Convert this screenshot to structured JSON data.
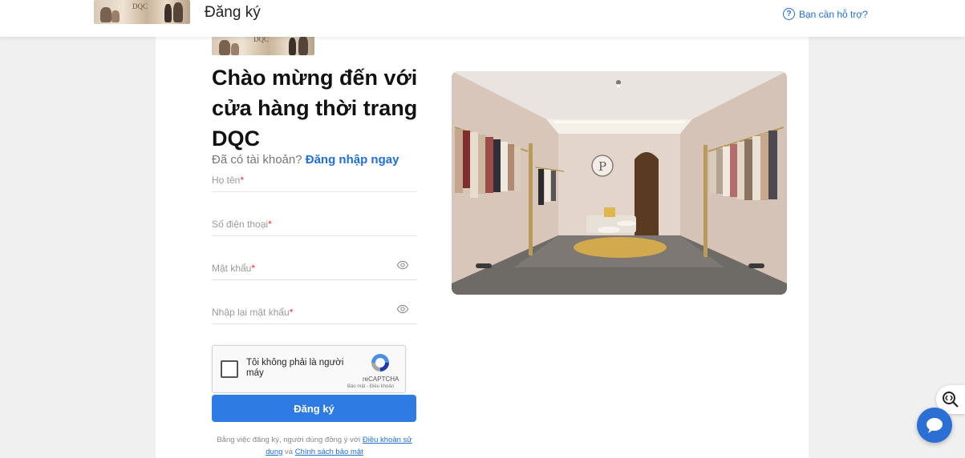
{
  "header": {
    "logo_text": "DQC",
    "title": "Đăng ký",
    "help_label": "Bạn cần hỗ trợ?",
    "help_icon": "question-circle-icon"
  },
  "form": {
    "logo_text": "DQC",
    "heading": "Chào mừng đến với cửa hàng thời trang DQC",
    "have_account": "Đã có tài khoản?",
    "login_link": "Đăng nhập ngay",
    "fields": [
      {
        "label": "Họ tên",
        "required": "*"
      },
      {
        "label": "Số điện thoại",
        "required": "*"
      },
      {
        "label": "Mật khẩu",
        "required": "*",
        "icon": "eye-icon"
      },
      {
        "label": "Nhập lại mật khẩu",
        "required": "*",
        "icon": "eye-icon"
      }
    ],
    "recaptcha": {
      "text": "Tôi không phải là người máy",
      "brand": "reCAPTCHA",
      "links": "Bảo mật - Điều khoản"
    },
    "submit_label": "Đăng ký",
    "terms": {
      "prefix": "Bằng việc đăng ký, người dùng đồng ý với",
      "link1": "Điều khoản sử dụng",
      "middle": "và",
      "link2": "Chính sách bảo mật"
    }
  },
  "colors": {
    "primary": "#2e7be3",
    "link": "#1f6fd6",
    "required": "#e03030",
    "background": "#f0f0f0"
  },
  "widgets": {
    "chat_icon": "chat-bubble-icon",
    "side_icon": "lens-icon"
  }
}
